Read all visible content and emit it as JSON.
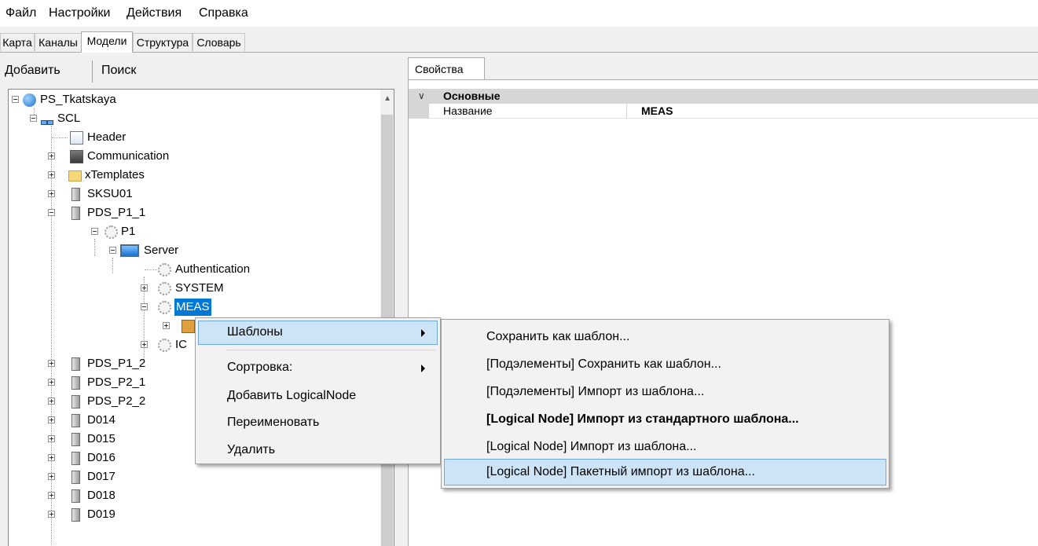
{
  "menubar": {
    "items": [
      "Файл",
      "Настройки",
      "Действия",
      "Справка"
    ]
  },
  "tabs": [
    "Карта",
    "Каналы",
    "Модели",
    "Структура",
    "Словарь"
  ],
  "toolbar": {
    "add": "Добавить",
    "search": "Поиск"
  },
  "tree": {
    "root": "PS_Tkatskaya",
    "scl": "SCL",
    "header": "Header",
    "communication": "Communication",
    "xtemplates": "xTemplates",
    "sksu01": "SKSU01",
    "pds_p1_1": "PDS_P1_1",
    "p1": "P1",
    "server": "Server",
    "authentication": "Authentication",
    "system": "SYSTEM",
    "meas": "MEAS",
    "ic_partial": "IC",
    "others": [
      "PDS_P1_2",
      "PDS_P2_1",
      "PDS_P2_2",
      "D014",
      "D015",
      "D016",
      "D017",
      "D018",
      "D019"
    ]
  },
  "properties": {
    "tab": "Свойства",
    "category": "Основные",
    "rows": [
      {
        "name": "Название",
        "value": "MEAS"
      }
    ]
  },
  "context_menu": {
    "items": [
      "Шаблоны",
      "Сортровка:",
      "Добавить LogicalNode",
      "Переименовать",
      "Удалить"
    ]
  },
  "submenu": {
    "items": [
      "Сохранить как шаблон...",
      "[Подэлементы] Сохранить как шаблон...",
      "[Подэлементы] Импорт из шаблона...",
      "[Logical Node] Импорт из стандартного шаблона...",
      "[Logical Node] Импорт из шаблона...",
      "[Logical Node] Пакетный импорт из шаблона..."
    ]
  },
  "colors": {
    "selection": "#0078d7",
    "menu_highlight": "#cde4f7",
    "category_bg": "#d6d6d6"
  }
}
